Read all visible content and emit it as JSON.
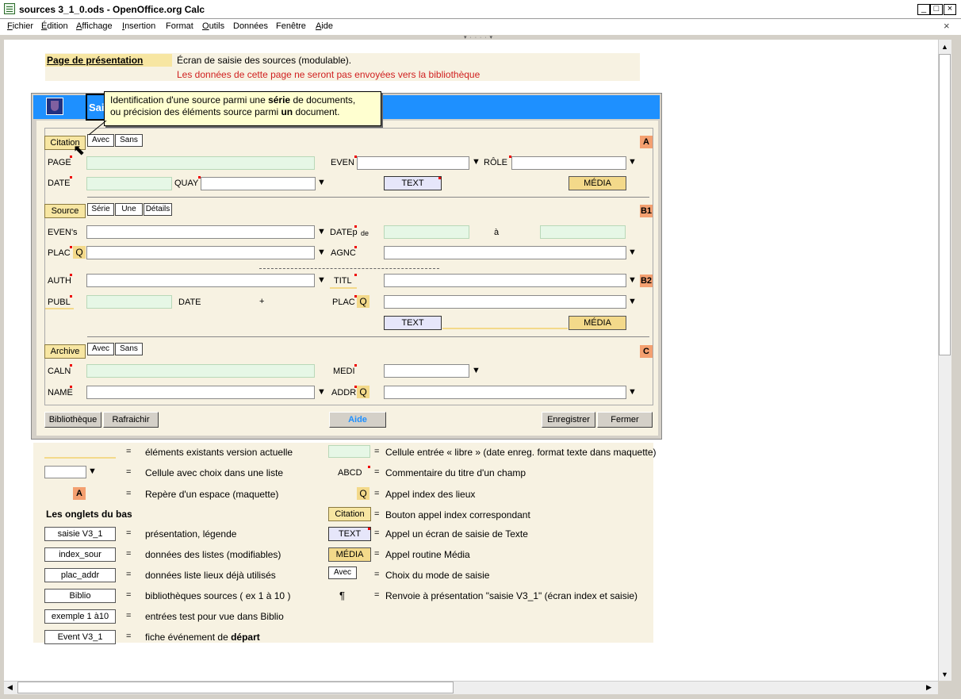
{
  "window": {
    "title": "sources 3_1_0.ods - OpenOffice.org Calc",
    "min": "_",
    "max": "□",
    "close": "×"
  },
  "menu": [
    {
      "u": "F",
      "r": "ichier"
    },
    {
      "u": "É",
      "r": "dition"
    },
    {
      "u": "A",
      "r": "ffichage"
    },
    {
      "u": "I",
      "r": "nsertion"
    },
    {
      "u": "",
      "r": "Format"
    },
    {
      "u": "O",
      "r": "utils"
    },
    {
      "u": "",
      "r": "Données"
    },
    {
      "u": "",
      "r": "Fenêtre"
    },
    {
      "u": "A",
      "r": "ide"
    }
  ],
  "doc_close": "×",
  "header": {
    "title": "Page de présentation",
    "line1": "Écran de saisie des sources (modulable).",
    "line2": "Les données de cette page ne seront pas envoyées vers la bibliothèque"
  },
  "form": {
    "title_fragment": "Sai"
  },
  "tooltip": {
    "l1a": "Identification d'une source parmi une ",
    "l1b": "série",
    "l1c": " de documents,",
    "l2a": "ou précision des éléments source parmi ",
    "l2b": "un",
    "l2c": " document."
  },
  "sectionA": {
    "tab": "Citation",
    "avec": "Avec",
    "sans": "Sans",
    "marker": "A",
    "page": "PAGE",
    "even": "EVEN",
    "role": "RÔLE",
    "date": "DATE",
    "quay": "QUAY",
    "text": "TEXT",
    "media": "MÉDIA"
  },
  "sectionB": {
    "tab": "Source",
    "serie": "Série",
    "une": "Une",
    "details": "Détails",
    "marker": "B1",
    "marker2": "B2",
    "evens": "EVEN's",
    "datep": "DATEp",
    "de": "de",
    "a": "à",
    "plac": "PLAC",
    "agnc": "AGNC",
    "auth": "AUTH",
    "titl": "TITL",
    "publ": "PUBL",
    "date": "DATE",
    "plus": "+",
    "plac2": "PLAC",
    "text": "TEXT",
    "media": "MÉDIA"
  },
  "sectionC": {
    "tab": "Archive",
    "avec": "Avec",
    "sans": "Sans",
    "marker": "C",
    "caln": "CALN",
    "medi": "MEDI",
    "name": "NAME",
    "addr": "ADDR"
  },
  "buttons": {
    "biblio": "Bibliothèque",
    "refresh": "Rafraichir",
    "aide": "Aide",
    "save": "Enregistrer",
    "close": "Fermer"
  },
  "icons": {
    "q": "Q",
    "dropdown": "▼"
  },
  "legend": {
    "eq": "=",
    "l1": "éléments existants version actuelle",
    "l2": "Cellule avec choix dans une liste",
    "l3m": "A",
    "l3": "Repère d'un espace (maquette)",
    "r1": "Cellule entrée « libre » (date enreg. format texte dans maquette)",
    "r2k": "ABCD",
    "r2": "Commentaire du titre d'un champ",
    "r3": "Appel index des lieux",
    "tabs_title": "Les onglets du bas",
    "r4k": "Citation",
    "r4": "Bouton appel index correspondant",
    "tabs": [
      {
        "k": "saisie V3_1",
        "v": "présentation, légende"
      },
      {
        "k": "index_sour",
        "v": "données des listes (modifiables)"
      },
      {
        "k": "plac_addr",
        "v": "données liste lieux déjà utilisés"
      },
      {
        "k": "Biblio",
        "v": "bibliothèques sources ( ex 1 à 10 )"
      },
      {
        "k": "exemple 1  à10",
        "v": "entrées test pour vue dans Biblio"
      },
      {
        "k": "Event V3_1",
        "v": "fiche événement de ",
        "vb": "départ"
      }
    ],
    "r5k": "TEXT",
    "r5": "Appel un écran de saisie de Texte",
    "r6k": "MÉDIA",
    "r6": "Appel routine Média",
    "r7k": "Avec",
    "r7": "Choix du mode de saisie",
    "r8k": "¶",
    "r8": "Renvoie à présentation \"saisie V3_1\" (écran index et saisie)"
  }
}
